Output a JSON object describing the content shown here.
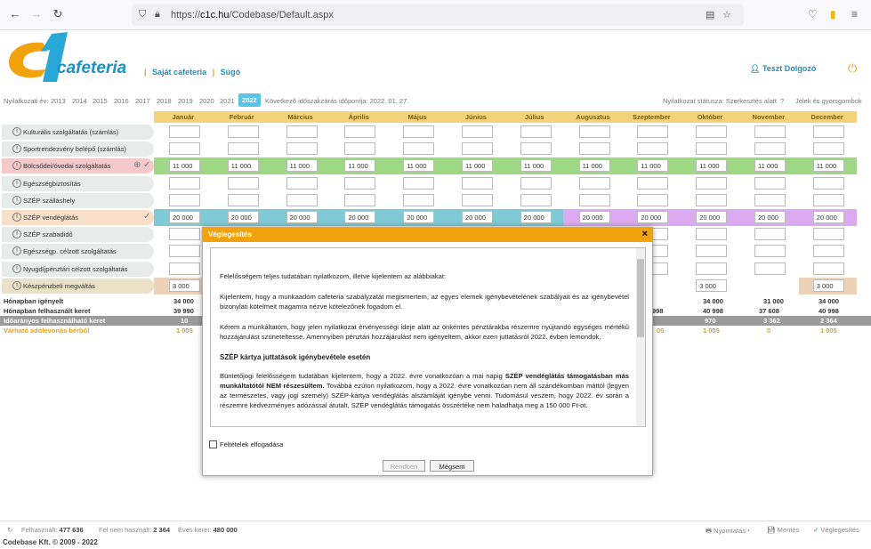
{
  "browser": {
    "url_prefix": "https://",
    "url_host": "c1c.hu",
    "url_path": "/Codebase/Default.aspx"
  },
  "header": {
    "logo_text": "cafeteria",
    "link1": "Saját cafeteria",
    "link2": "Súgó",
    "sep": "|",
    "user": "Teszt Dolgozó"
  },
  "years": {
    "label": "Nyilatkozati év:",
    "list": [
      "2013",
      "2014",
      "2015",
      "2016",
      "2017",
      "2018",
      "2019",
      "2020",
      "2021"
    ],
    "active": "2022",
    "next_close": "Következő időszakzárás időpontja: 2022. 01. 27.",
    "status": "Nyilatkozat státusza: Szerkesztés alatt",
    "legend": "Jelek és gyorsgombok"
  },
  "months": [
    "Január",
    "Február",
    "Március",
    "Április",
    "Május",
    "Június",
    "Július",
    "Augusztus",
    "Szeptember",
    "Október",
    "November",
    "December"
  ],
  "rows": [
    {
      "label": "Kulturális szolgáltatás (számlás)",
      "color": "#e7ecea"
    },
    {
      "label": "Sportrendezvény belépő (számlás)",
      "color": "#e7ecea"
    },
    {
      "label": "Bölcsődei/óvodai szolgáltatás",
      "color": "#f3c9c9",
      "value": "11 000"
    },
    {
      "label": "Egészségbiztosítás",
      "color": "#e7ecea"
    },
    {
      "label": "SZÉP szálláshely",
      "color": "#e7ecea"
    },
    {
      "label": "SZÉP vendéglátás",
      "color": "#f7dfc8",
      "value": "20 000"
    },
    {
      "label": "SZÉP szabadidő",
      "color": "#e7ecea"
    },
    {
      "label": "Egészségp. célzott szolgáltatás",
      "color": "#e7ecea"
    },
    {
      "label": "Nyugdíjpénztári célzott szolgáltatás",
      "color": "#e7ecea"
    },
    {
      "label": "Készpénzbeli megváltás",
      "color": "#eae1c8",
      "value": "3 000"
    }
  ],
  "summary": {
    "r1": {
      "label": "Hónapban igényelt",
      "vals": [
        "34 000",
        "34 000",
        "31 000",
        "34 000"
      ]
    },
    "r2": {
      "label": "Hónapban felhasznált keret",
      "vals": [
        "39 990",
        "998",
        "40 998",
        "37 608",
        "40 998"
      ]
    },
    "r3": {
      "label": "Időarányos felhasználható keret",
      "vals": [
        "10",
        "970",
        "3 362",
        "2 364"
      ]
    },
    "r4": {
      "label": "Várható adólevonás bérből",
      "vals": [
        "1 005",
        "05",
        "1 005",
        "0",
        "1 005"
      ]
    }
  },
  "footer": {
    "used_label": "Felhasznált:",
    "used": "477 636",
    "unused_label": "Fel nem használt:",
    "unused": "2 364",
    "annual_label": "Éves keret:",
    "annual": "480 000",
    "print": "Nyomtatás",
    "save": "Mentés",
    "finalize": "Véglegesítés",
    "copyright": "Codebase Kft. © 2009 - 2022"
  },
  "modal": {
    "title": "Véglegesítés",
    "close": "×",
    "p1": "Felelősségem teljes tudatában nyilatkozom, illetve kijelentem az alábbiakat:",
    "p2": "Kijelentem, hogy a munkaadóm cafeteria szabályzatát megismertem, az egyes elemek igénybevételének szabályait és az igénybevétel bizonylati kötelmeit magamra nézve kötelezőnek fogadom el.",
    "p3": "Kérem a munkáltatóm, hogy jelen nyilatkozat érvényességi ideje alatt az önkéntes pénztárakba részemre nyújtandó egységes mértékű hozzájárulást szüneteltesse. Amennyiben pénztári hozzájárulást nem igényeltem, akkor ezen juttatásról 2022. évben lemondok.",
    "h": "SZÉP kártya juttatások igénybevétele esetén",
    "p4a": "Büntetőjogi felelősségem tudatában kijelentem, hogy a 2022. évre vonatkozóan a mai napig ",
    "p4b": "SZÉP vendéglátás támogatásban más munkáltatótól NEM részesültem.",
    "p4c": " Továbbá ezúton nyilatkozom, hogy a 2022. évre vonatkozóan nem áll szándékomban máttól (legyen az természetes, vagy jogi személy) SZÉP-kártya vendéglátás alszámláját igénybe venni. Tudomásul veszem, hogy 2022. év során a részemre kedvezményes adózással átutalt, SZÉP vendéglátás támogatás összértéke nem haladhatja meg a 150 000 Ft-ot.",
    "accept": "Feltételek elfogadása",
    "ok": "Rendben",
    "cancel": "Mégsem"
  }
}
